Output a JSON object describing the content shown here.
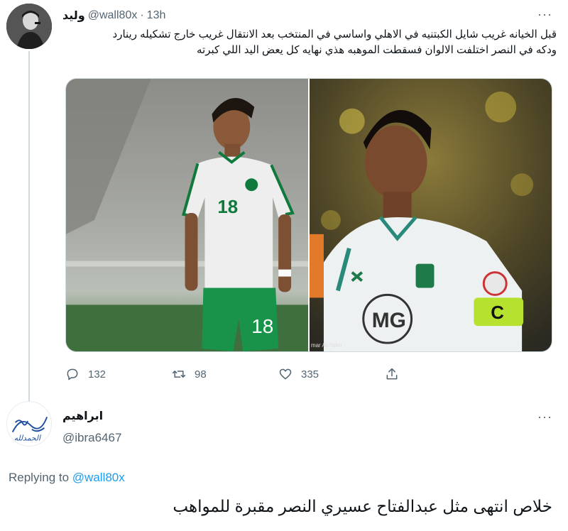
{
  "tweet1": {
    "display_name": "وليد",
    "handle": "@wall80x",
    "separator": "·",
    "time": "13h",
    "more": "···",
    "text_lines": [
      "قبل الخيانه غريب شايل الكبتنيه في الاهلي واساسي في المنتخب بعد الانتقال غريب خارج تشكيله رينارد",
      "ودكه في النصر اختلفت الالوان فسقطت الموهبه هذي نهايه كل  يعض اليد اللي كبرته"
    ],
    "photos": [
      {
        "jersey_number": "18",
        "description": "player-in-green-white-kit"
      },
      {
        "sponsor_text": "MG",
        "armband_letter": "C",
        "watermark": "mar Al-Yahri"
      }
    ],
    "actions": {
      "replies": "132",
      "retweets": "98",
      "likes": "335"
    }
  },
  "tweet2": {
    "display_name": "ابراهيم",
    "handle": "@ibra6467",
    "more": "···",
    "avatar_signature": "الحمدلله",
    "replying_label": "Replying to",
    "replying_handle": "@wall80x",
    "text": "خلاص انتهى مثل عبدالفتاح عسيري النصر مقبرة للمواهب"
  },
  "colors": {
    "primary_text": "#0f1419",
    "secondary_text": "#536471",
    "link": "#1d9bf0",
    "thread_line": "#cfd9de"
  }
}
